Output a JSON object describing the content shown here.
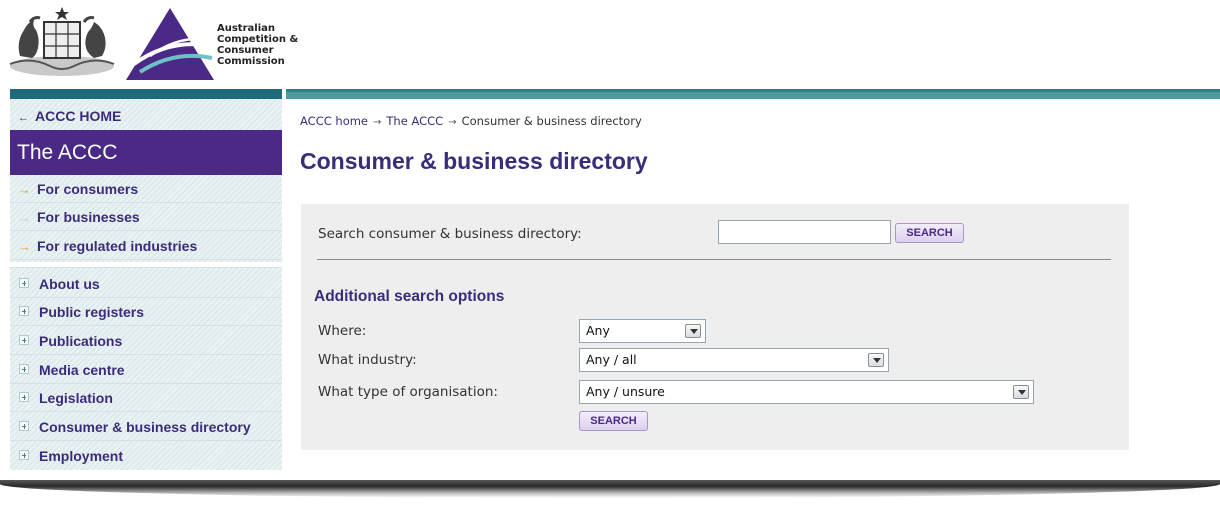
{
  "header": {
    "org_name_lines": [
      "Australian",
      "Competition &",
      "Consumer",
      "Commission"
    ]
  },
  "colors": {
    "brand_purple": "#4a2a86",
    "brand_teal": "#1d6b78",
    "link_purple": "#3b2c7a",
    "accent_orange": "#f0a020"
  },
  "sidebar": {
    "home_label": "ACCC HOME",
    "section_title": "The ACCC",
    "audience_items": [
      {
        "label": "For consumers",
        "icon": "arrow-right-icon"
      },
      {
        "label": "For businesses",
        "icon": "arrow-right-icon"
      },
      {
        "label": "For regulated industries",
        "icon": "arrow-right-icon"
      }
    ],
    "nav_items": [
      {
        "label": "About us",
        "icon": "plus-expand-icon"
      },
      {
        "label": "Public registers",
        "icon": "plus-expand-icon"
      },
      {
        "label": "Publications",
        "icon": "plus-expand-icon"
      },
      {
        "label": "Media centre",
        "icon": "plus-expand-icon"
      },
      {
        "label": "Legislation",
        "icon": "plus-expand-icon"
      },
      {
        "label": "Consumer & business directory",
        "icon": "plus-expand-icon"
      },
      {
        "label": "Employment",
        "icon": "plus-expand-icon"
      }
    ]
  },
  "breadcrumb": {
    "items": [
      "ACCC home",
      "The ACCC",
      "Consumer & business directory"
    ]
  },
  "main": {
    "title": "Consumer & business directory",
    "search": {
      "label": "Search consumer & business directory:",
      "value": "",
      "button_label": "SEARCH"
    },
    "advanced": {
      "title": "Additional search options",
      "where_label": "Where:",
      "where_value": "Any",
      "industry_label": "What industry:",
      "industry_value": "Any / all",
      "orgtype_label": "What type of organisation:",
      "orgtype_value": "Any / unsure",
      "button_label": "SEARCH"
    }
  }
}
